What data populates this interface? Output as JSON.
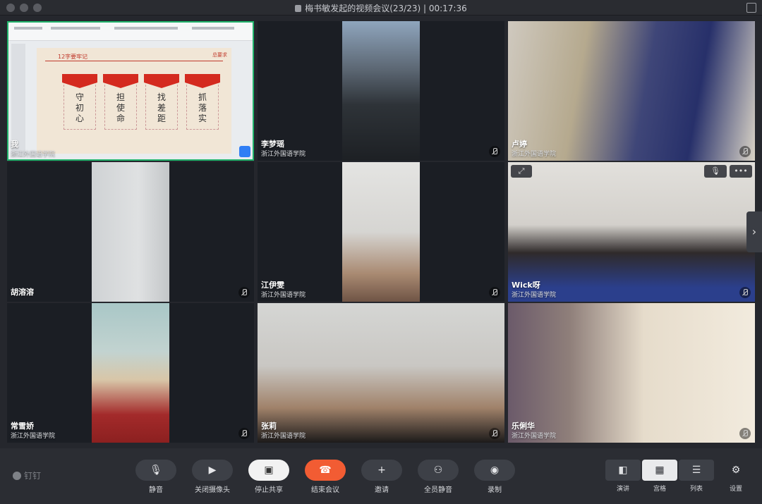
{
  "window": {
    "title": "梅书敏发起的视频会议(23/23) | 00:17:36"
  },
  "tiles": [
    {
      "name": "我",
      "org": "浙江外国语学院"
    },
    {
      "name": "李梦瑶",
      "org": "浙江外国语学院"
    },
    {
      "name": "卢婷",
      "org": "浙江外国语学院"
    },
    {
      "name": "胡溶溶",
      "org": ""
    },
    {
      "name": "江伊雯",
      "org": "浙江外国语学院"
    },
    {
      "name": "Wick呀",
      "org": "浙江外国语学院"
    },
    {
      "name": "常雪娇",
      "org": "浙江外国语学院"
    },
    {
      "name": "张莉",
      "org": "浙江外国语学院"
    },
    {
      "name": "乐俐华",
      "org": "浙江外国语学院"
    }
  ],
  "share": {
    "slide_title": "12字要牢记",
    "corner_label": "总要求",
    "cards": [
      {
        "text": "守初心"
      },
      {
        "text": "担使命"
      },
      {
        "text": "找差距"
      },
      {
        "text": "抓落实"
      }
    ]
  },
  "toolbar": {
    "brand": "钉钉",
    "buttons": [
      {
        "label": "静音",
        "icon": "microphone-icon"
      },
      {
        "label": "关闭摄像头",
        "icon": "camera-icon"
      },
      {
        "label": "停止共享",
        "icon": "screen-share-icon"
      },
      {
        "label": "结束会议",
        "icon": "phone-hangup-icon"
      },
      {
        "label": "邀请",
        "icon": "add-person-icon"
      },
      {
        "label": "全员静音",
        "icon": "mute-all-icon"
      },
      {
        "label": "录制",
        "icon": "record-icon"
      }
    ],
    "layouts": [
      {
        "label": "演讲",
        "icon": "speaker-layout-icon",
        "selected": false
      },
      {
        "label": "宫格",
        "icon": "grid-layout-icon",
        "selected": true
      },
      {
        "label": "列表",
        "icon": "list-layout-icon",
        "selected": false
      }
    ],
    "settings_label": "设置"
  },
  "colors": {
    "end_button": "#f25c33",
    "active_speaker": "#21b36b",
    "party_red": "#d42a1f"
  }
}
